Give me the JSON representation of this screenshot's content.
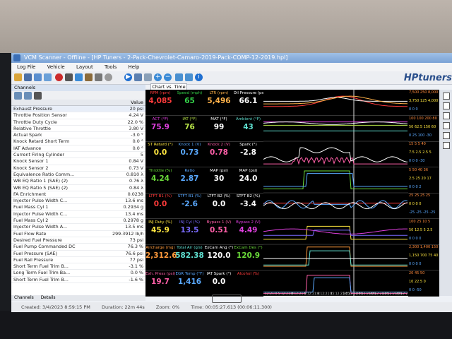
{
  "window": {
    "title": "VCM Scanner - Offline - [HP Tuners - 2-Pack-Chevrolet-Camaro-2019-Pack-COMP-12-2019.hpl]"
  },
  "menu": [
    "Log File",
    "Vehicle",
    "Layout",
    "Tools",
    "Help"
  ],
  "brand": {
    "logo": "HPtuners"
  },
  "channels": {
    "title": "Channels",
    "col_value": "Value",
    "rows": [
      {
        "name": "Exhaust Pressure",
        "value": "20 psi"
      },
      {
        "name": "Throttle Position Sensor",
        "value": "4.24 V"
      },
      {
        "name": "Throttle Duty Cycle",
        "value": "22.0 %"
      },
      {
        "name": "Relative Throttle",
        "value": "3.80 V"
      },
      {
        "name": "Actual Spark",
        "value": "-3.0 °"
      },
      {
        "name": "Knock Retard Short Term",
        "value": "0.0 °"
      },
      {
        "name": "IAT Advance",
        "value": "0.0 °"
      },
      {
        "name": "Current Firing Cylinder",
        "value": "5"
      },
      {
        "name": "Knock Sensor 1",
        "value": "0.84 V"
      },
      {
        "name": "Knock Sensor 2",
        "value": "0.73 V"
      },
      {
        "name": "Equivalence Ratio Comm...",
        "value": "0.810 λ"
      },
      {
        "name": "WB EQ Ratio 1 (SAE) (2)",
        "value": "0.76 λ"
      },
      {
        "name": "WB EQ Ratio 5 (SAE) (2)",
        "value": "0.84 λ"
      },
      {
        "name": "FA Enrichment",
        "value": "0.0238"
      },
      {
        "name": "Injector Pulse Width C...",
        "value": "13.6 ms"
      },
      {
        "name": "Fuel Mass Cyl 1",
        "value": "0.2934 g"
      },
      {
        "name": "Injector Pulse Width C...",
        "value": "13.4 ms"
      },
      {
        "name": "Fuel Mass Cyl 2",
        "value": "0.2978 g"
      },
      {
        "name": "Injector Pulse Width A...",
        "value": "13.5 ms"
      },
      {
        "name": "Fuel Flow Rate",
        "value": "299.3912 lb/h"
      },
      {
        "name": "Desired Fuel Pressure",
        "value": "73 psi"
      },
      {
        "name": "Fuel Pump Commanded DC",
        "value": "76.3 %"
      },
      {
        "name": "Fuel Pressure (SAE)",
        "value": "76.6 psi"
      },
      {
        "name": "Fuel Rail Pressure",
        "value": "77 psi"
      },
      {
        "name": "Short Term Fuel Trim B...",
        "value": "-3.1 %"
      },
      {
        "name": "Long Term Fuel Trim Ba...",
        "value": "0.0 %"
      },
      {
        "name": "Short Term Fuel Trim B...",
        "value": "-1.6 %"
      }
    ]
  },
  "tabs": {
    "panel": [
      "Channels",
      "Details"
    ],
    "chart": "Chart vs. Time"
  },
  "gauges": [
    [
      {
        "label": "RPM (rpm)",
        "value": "4,085",
        "color": "#ff3b3b"
      },
      {
        "label": "Speed (mph)",
        "value": "65",
        "color": "#34d24a"
      },
      {
        "label": "LTR (rpm)",
        "value": "5,496",
        "color": "#ffb24a"
      },
      {
        "label": "Oil Pressure (psi)",
        "value": "66.1",
        "color": "#ffffff"
      }
    ],
    [
      {
        "label": "ACT (°F)",
        "value": "75.9",
        "color": "#e040e0"
      },
      {
        "label": "IAT (°F)",
        "value": "76",
        "color": "#bbe84a"
      },
      {
        "label": "MAT (°F)",
        "value": "99",
        "color": "#ffffff"
      },
      {
        "label": "Ambient (°F)",
        "value": "43",
        "color": "#5fe0d0"
      }
    ],
    [
      {
        "label": "ST Retard (°)",
        "value": "0.0",
        "color": "#ffe640"
      },
      {
        "label": "Knock 1 (V)",
        "value": "0.73",
        "color": "#5aa9ff"
      },
      {
        "label": "Knock 2 (V)",
        "value": "0.78",
        "color": "#ff5fa8"
      },
      {
        "label": "Spark (°)",
        "value": "-2.8",
        "color": "#ffffff"
      }
    ],
    [
      {
        "label": "Throttle (%)",
        "value": "4.24",
        "color": "#6bdc3a"
      },
      {
        "label": "Ratio",
        "value": "2.87",
        "color": "#5aa9ff"
      },
      {
        "label": "MAP (psi)",
        "value": "30",
        "color": "#ffffff"
      },
      {
        "label": "MAP (psi)",
        "value": "24.0",
        "color": "#ffffff"
      }
    ],
    [
      {
        "label": "LTFT B1 (%)",
        "value": "0.0",
        "color": "#ff3b3b"
      },
      {
        "label": "STFT B1 (%)",
        "value": "-2.6",
        "color": "#5aa9ff"
      },
      {
        "label": "LTFT B2 (%)",
        "value": "0.0",
        "color": "#ffffff"
      },
      {
        "label": "STFT B2 (%)",
        "value": "-3.4",
        "color": "#ffffff"
      }
    ],
    [
      {
        "label": "INJ Duty (%)",
        "value": "45.9",
        "color": "#ffe640"
      },
      {
        "label": "INJ Cyl (%)",
        "value": "13.5",
        "color": "#7a6bff"
      },
      {
        "label": "Bypass 1 (V)",
        "value": "0.51",
        "color": "#ff5fa8"
      },
      {
        "label": "Bypass 2 (V)",
        "value": "4.49",
        "color": "#e040e0"
      }
    ],
    [
      {
        "label": "Aircharge (mg)",
        "value": "2,312.6",
        "color": "#ff9a3c"
      },
      {
        "label": "Total Air (g/s)",
        "value": "582.38",
        "color": "#5fe0d0"
      },
      {
        "label": "ExCam Ang (°)",
        "value": "120.0",
        "color": "#ffffff"
      },
      {
        "label": "ExCam Des (°)",
        "value": "120.9",
        "color": "#6bdc3a"
      }
    ],
    [
      {
        "label": "Exh. Press (psi)",
        "value": "19.7",
        "color": "#ff5fa8"
      },
      {
        "label": "EGR Temp (°F)",
        "value": "1,416",
        "color": "#5aa9ff"
      },
      {
        "label": "IAT Spark (°)",
        "value": "0.0",
        "color": "#ffffff"
      },
      {
        "label": "Alcohol (%)",
        "value": "",
        "color": "#ff3b3b"
      }
    ]
  ],
  "scales": [
    [
      "7,500  250  8,000 80",
      "3,750  125  4,000 40",
      "0  0  0"
    ],
    [
      "100  100  200  80",
      "50  62.5  150  60",
      "0  25  100  -30"
    ],
    [
      "15  5  5  40",
      "7.5  2.5  2.5  5",
      "0  0  0  -30"
    ],
    [
      "5  50  40  36",
      "2.5  25  20  17",
      "0  0  0  2"
    ],
    [
      "25  25  25  25",
      "0  0  0  0",
      "-25  -25  -25  -25"
    ],
    [
      "100  25  10  5",
      "50  12.5  5  2.5",
      "0  0  0  0"
    ],
    [
      "2,300  1,400  150  50",
      "1,150  700  75  40",
      "0  0  0  0"
    ],
    [
      "20  45  50",
      "10  22.5  0",
      "0  0  -50"
    ]
  ],
  "time_axis": [
    "12:21:0",
    "5:12:21:0",
    "8:12:21:0",
    "5:12:21:0",
    "8:12:21:1",
    "05:12:21:05",
    "24:12:21:05",
    "27:12:21:05",
    "30:12:21:05",
    "33:12:21:05",
    "36:12:21:05:39"
  ],
  "status": {
    "created": "Created: 3/4/2023 8:59:15 PM",
    "duration": "Duration: 22m 44s",
    "zoom": "Zoom: 0%",
    "time": "Time: 00:05:27.613 (00:06:11.300)"
  }
}
